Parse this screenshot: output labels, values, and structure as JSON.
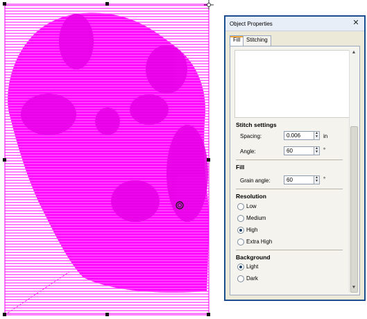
{
  "panel": {
    "title": "Object Properties",
    "close_glyph": "✕",
    "tabs": [
      {
        "label": "Fill",
        "active": true
      },
      {
        "label": "Stitching",
        "active": false
      }
    ]
  },
  "stitch_settings": {
    "title": "Stitch settings",
    "spacing_label": "Spacing:",
    "spacing_value": "0.006",
    "spacing_unit": "in",
    "angle_label": "Angle:",
    "angle_value": "60",
    "angle_unit": "°"
  },
  "fill": {
    "title": "Fill",
    "grain_label": "Grain angle:",
    "grain_value": "60",
    "grain_unit": "°"
  },
  "resolution": {
    "title": "Resolution",
    "options": [
      {
        "label": "Low",
        "selected": false
      },
      {
        "label": "Medium",
        "selected": false
      },
      {
        "label": "High",
        "selected": true
      },
      {
        "label": "Extra High",
        "selected": false
      }
    ]
  },
  "background": {
    "title": "Background",
    "options": [
      {
        "label": "Light",
        "selected": true
      },
      {
        "label": "Dark",
        "selected": false
      }
    ]
  },
  "icons": [
    "close-icon",
    "move-cursor-icon",
    "rotation-handle-icon",
    "spin-up-icon",
    "spin-down-icon"
  ],
  "colors": {
    "stitch": "#ff00ff",
    "panel_border": "#1b4e8f",
    "panel_bg": "#ece9d8"
  }
}
